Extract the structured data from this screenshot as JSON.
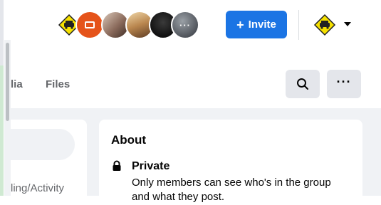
{
  "header": {
    "member_avatars": [
      {
        "name": "group-logo-avatar"
      },
      {
        "name": "orange-card-avatar"
      },
      {
        "name": "member-photo-avatar-1"
      },
      {
        "name": "member-photo-avatar-2"
      },
      {
        "name": "dark-silhouette-avatar"
      },
      {
        "name": "more-members-avatar",
        "label": "···"
      }
    ],
    "invite_button": {
      "icon": "+",
      "label": "Invite"
    },
    "profile_caret_icon": "caret-down-icon"
  },
  "tabs": {
    "items": [
      {
        "label": "lia"
      },
      {
        "label": "Files"
      }
    ],
    "search_icon": "search-icon",
    "more_label": "···"
  },
  "sidebar": {
    "partial_text": "ling/Activity"
  },
  "about": {
    "title": "About",
    "privacy_title": "Private",
    "privacy_desc": "Only members can see who's in the group",
    "privacy_desc_cont": "and what they post."
  },
  "colors": {
    "accent": "#1b74e4",
    "background": "#f0f2f5",
    "button_gray": "#e4e6eb"
  }
}
